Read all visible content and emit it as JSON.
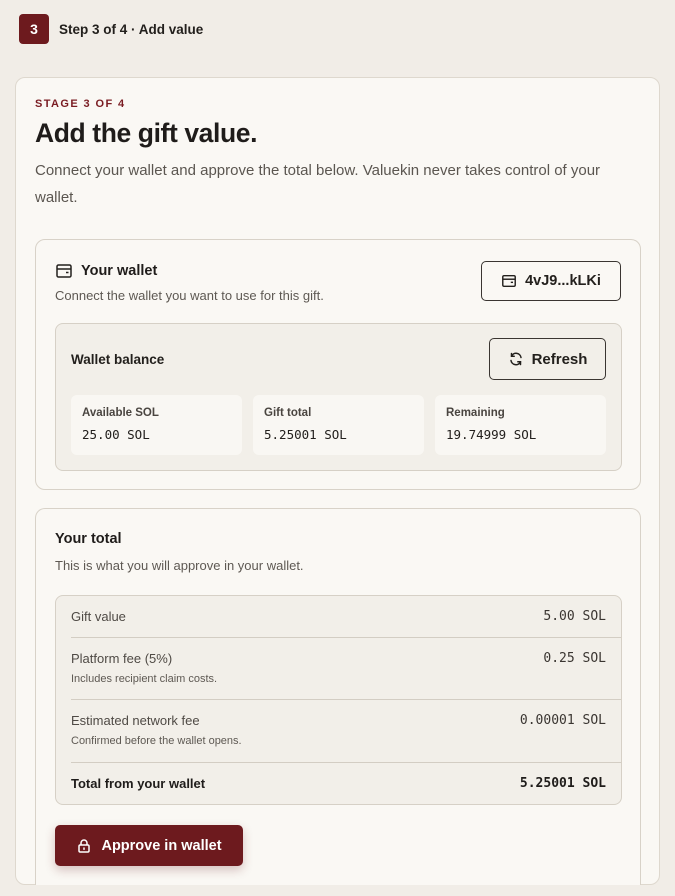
{
  "header": {
    "step_number": "3",
    "step_label": "Step 3 of 4 · Add value"
  },
  "card": {
    "eyebrow": "STAGE 3 OF 4",
    "title": "Add the gift value.",
    "intro": "Connect your wallet and approve the total below. Valuekin never takes control of your wallet."
  },
  "wallet": {
    "title": "Your wallet",
    "subtitle": "Connect the wallet you want to use for this gift.",
    "address_label": "4vJ9...kLKi",
    "icon": "wallet-icon",
    "balance": {
      "title": "Wallet balance",
      "refresh_label": "Refresh",
      "refresh_icon": "refresh-icon",
      "stats": [
        {
          "label": "Available SOL",
          "value": "25.00 SOL"
        },
        {
          "label": "Gift total",
          "value": "5.25001 SOL"
        },
        {
          "label": "Remaining",
          "value": "19.74999 SOL"
        }
      ]
    }
  },
  "total": {
    "title": "Your total",
    "subtitle": "This is what you will approve in your wallet.",
    "rows": [
      {
        "label": "Gift value",
        "note": "",
        "value": "5.00 SOL"
      },
      {
        "label": "Platform fee (5%)",
        "note": "Includes recipient claim costs.",
        "value": "0.25 SOL"
      },
      {
        "label": "Estimated network fee",
        "note": "Confirmed before the wallet opens.",
        "value": "0.00001 SOL"
      },
      {
        "label": "Total from your wallet",
        "note": "",
        "value": "5.25001 SOL"
      }
    ],
    "approve_label": "Approve in wallet",
    "approve_icon": "lock-icon"
  },
  "colors": {
    "brand": "#6d1a1e",
    "background": "#f1ede7",
    "card": "#faf8f4"
  }
}
